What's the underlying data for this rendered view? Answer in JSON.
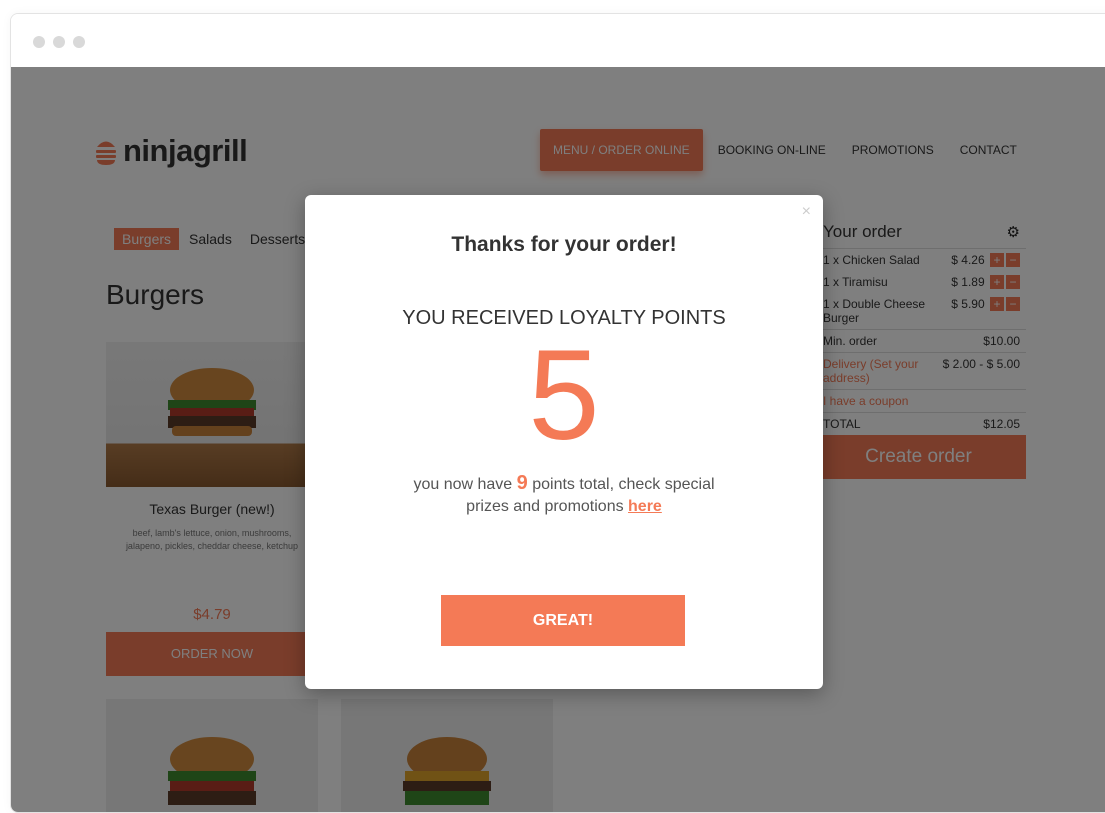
{
  "brand": {
    "name": "ninjagrill"
  },
  "nav": {
    "items": [
      {
        "label": "MENU / ORDER ONLINE"
      },
      {
        "label": "BOOKING ON-LINE"
      },
      {
        "label": "PROMOTIONS"
      },
      {
        "label": "CONTACT"
      }
    ]
  },
  "categories": [
    "Burgers",
    "Salads",
    "Desserts"
  ],
  "section": {
    "title": "Burgers"
  },
  "product": {
    "name": "Texas Burger (new!)",
    "description": "beef, lamb's lettuce, onion, mushrooms, jalapeno, pickles, cheddar cheese, ketchup",
    "price": "$4.79",
    "cta": "ORDER NOW"
  },
  "order": {
    "title": "Your order",
    "items": [
      {
        "name": "1 x Chicken Salad",
        "price": "$ 4.26"
      },
      {
        "name": "1 x Tiramisu",
        "price": "$ 1.89"
      },
      {
        "name": "1 x Double Cheese Burger",
        "price": "$ 5.90"
      }
    ],
    "min_label": "Min. order",
    "min_value": "$10.00",
    "delivery_label": "Delivery (Set your address)",
    "delivery_value": "$ 2.00 - $ 5.00",
    "coupon": "I have a coupon",
    "total_label": "TOTAL",
    "total_value": "$12.05",
    "plus": "+",
    "minus": "−",
    "create_label": "Create order"
  },
  "modal": {
    "close": "×",
    "title": "Thanks for your order!",
    "subtitle": "YOU RECEIVED LOYALTY POINTS",
    "points": "5",
    "text_before": "you now have ",
    "total_points": "9",
    "text_after": " points total, check special prizes and promotions ",
    "link": "here",
    "button": "GREAT!"
  },
  "colors": {
    "accent": "#f47a56",
    "overlay": "rgba(0,0,0,0.5)"
  }
}
